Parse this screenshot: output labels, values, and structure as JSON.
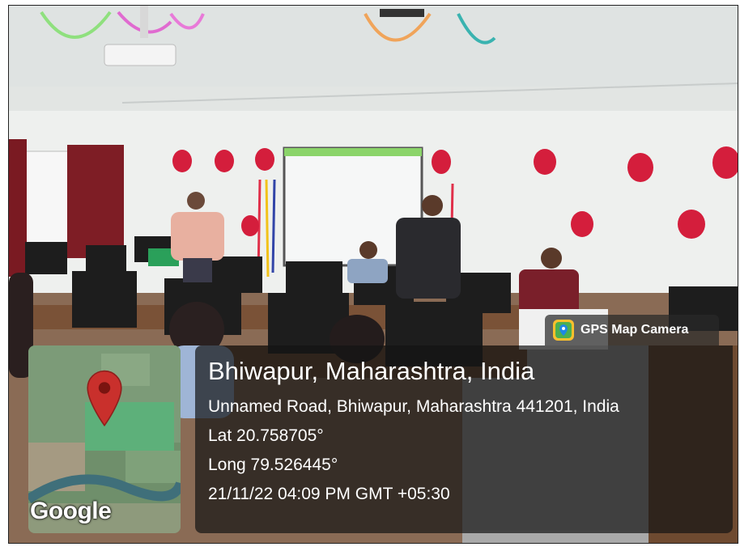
{
  "overlay": {
    "app_name": "GPS Map Camera",
    "location_title": "Bhiwapur, Maharashtra, India",
    "address": "Unnamed Road, Bhiwapur, Maharashtra 441201, India",
    "latitude": "Lat 20.758705°",
    "longitude": "Long 79.526445°",
    "datetime": "21/11/22 04:09 PM GMT +05:30",
    "map_brand": "Google"
  },
  "icons": [
    "gps-map-camera-app-icon",
    "map-pin-icon"
  ],
  "colors": {
    "overlay_bg": "#141414",
    "pin": "#c9302c",
    "balloon": "#d41e3c"
  }
}
